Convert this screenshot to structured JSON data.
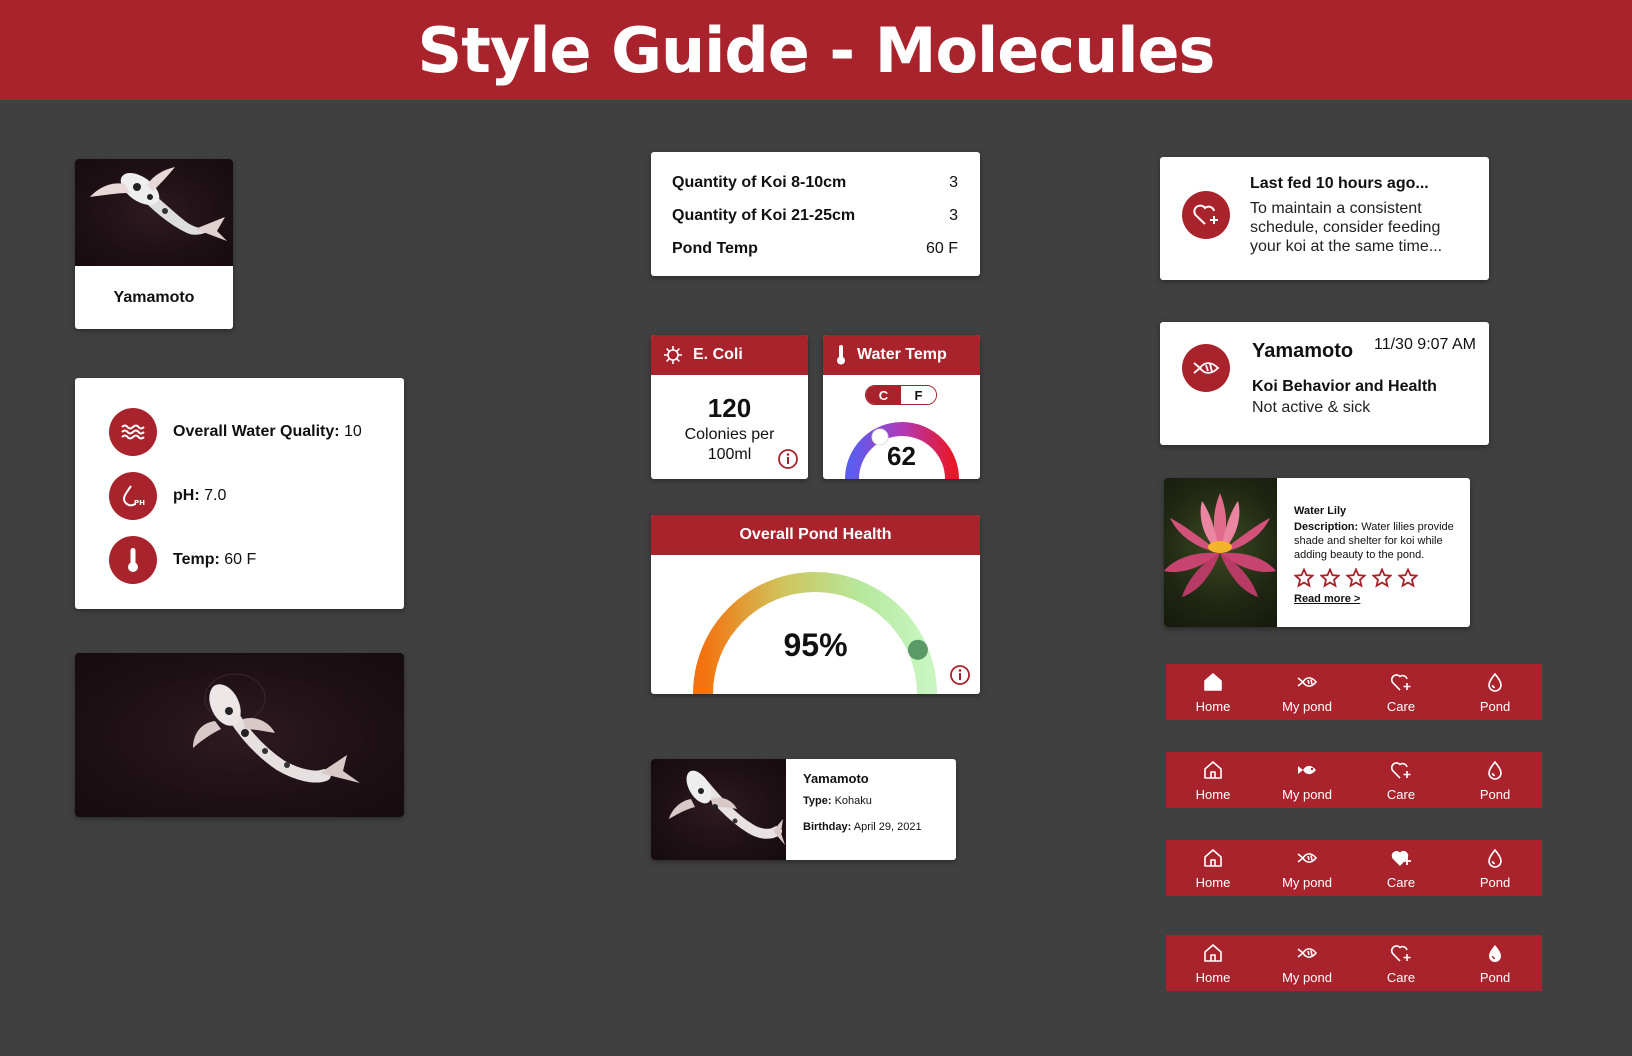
{
  "header": {
    "title": "Style Guide - Molecules"
  },
  "koi_card": {
    "name": "Yamamoto"
  },
  "water_quality": {
    "rows": [
      {
        "label": "Overall Water Quality:",
        "value": "10"
      },
      {
        "label": "pH:",
        "value": "7.0"
      },
      {
        "label": "Temp:",
        "value": "60 F"
      }
    ],
    "ph_icon_text": "PH"
  },
  "stats_table": {
    "rows": [
      {
        "label": "Quantity of Koi 8-10cm",
        "value": "3"
      },
      {
        "label": "Quantity of Koi 21-25cm",
        "value": "3"
      },
      {
        "label": "Pond Temp",
        "value": "60 F"
      }
    ]
  },
  "ecoli": {
    "title": "E. Coli",
    "value": "120",
    "unit": "Colonies per 100ml"
  },
  "water_temp": {
    "title": "Water Temp",
    "toggle_c": "C",
    "toggle_f": "F",
    "value": "62"
  },
  "pond_health": {
    "title": "Overall Pond Health",
    "value": "95%",
    "fraction": 0.95
  },
  "koi_detail": {
    "name": "Yamamoto",
    "type_label": "Type:",
    "type_value": "Kohaku",
    "birthday_label": "Birthday:",
    "birthday_value": "April 29, 2021"
  },
  "feed_notice": {
    "title": "Last fed 10 hours ago...",
    "text": "To maintain a consistent schedule, consider feeding your koi at the same time..."
  },
  "behavior_notice": {
    "name": "Yamamoto",
    "timestamp": "11/30 9:07 AM",
    "subtitle": "Koi Behavior and Health",
    "status": "Not active & sick"
  },
  "plant_card": {
    "name": "Water Lily",
    "desc_label": "Description:",
    "desc_text": "Water lilies provide shade and shelter for koi while adding beauty to the pond.",
    "rating": 0,
    "link": "Read more >"
  },
  "nav_bar": {
    "items": [
      "Home",
      "My pond",
      "Care",
      "Pond"
    ]
  },
  "colors": {
    "brand": "#a8232c",
    "background": "#404040"
  }
}
